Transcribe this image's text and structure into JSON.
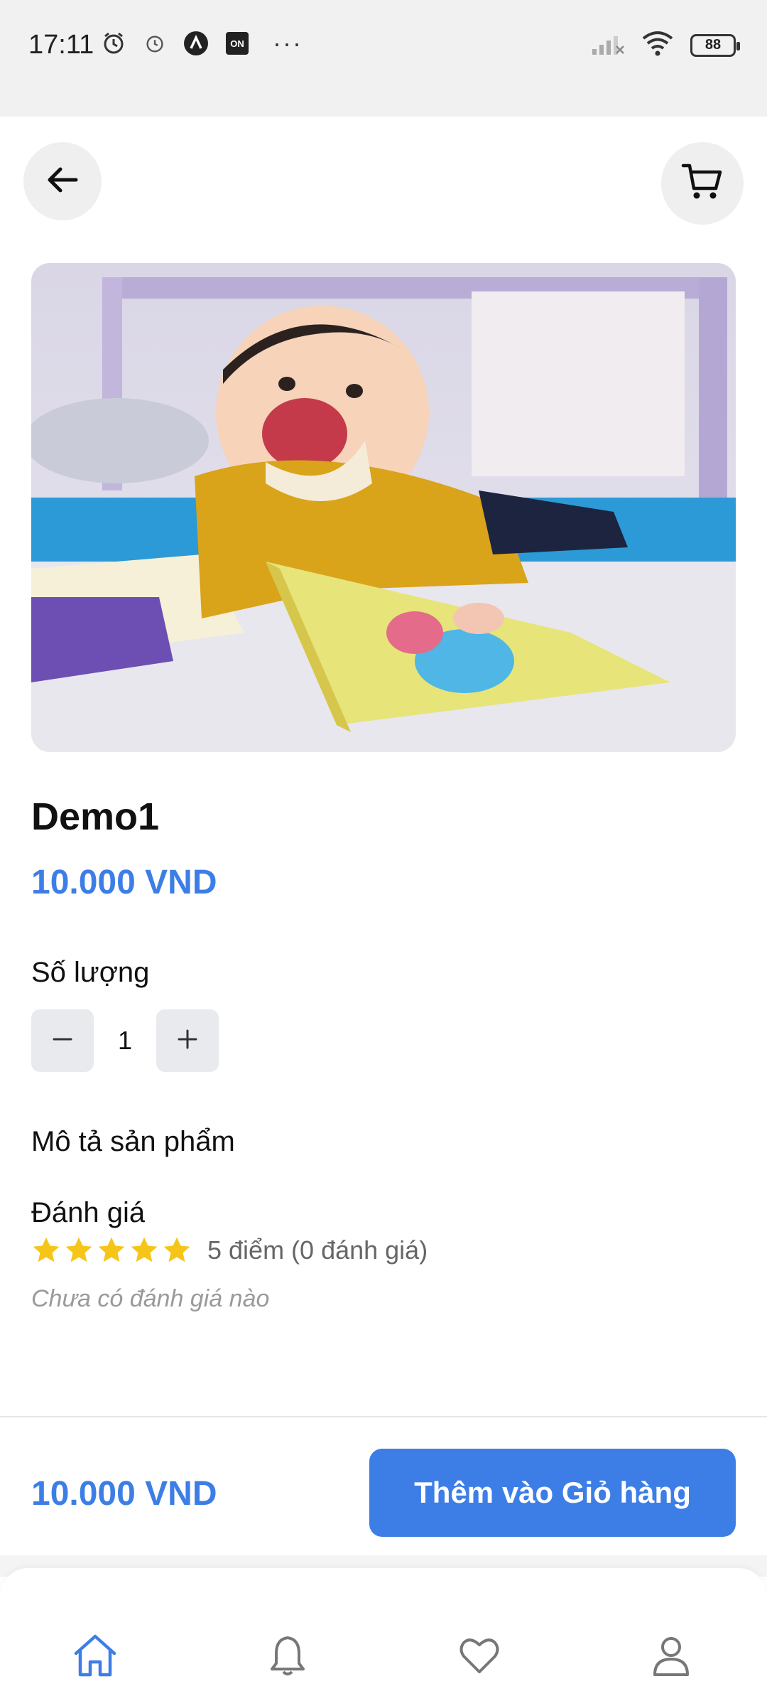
{
  "status_bar": {
    "time": "17:11",
    "battery": "88",
    "icons_left": [
      "alarm-clock-icon",
      "alarm-icon",
      "app-a-icon",
      "on-badge-icon"
    ],
    "more": "···",
    "icons_right": [
      "signal-icon",
      "wifi-icon",
      "battery-icon"
    ]
  },
  "header": {
    "back_icon": "arrow-left-icon",
    "cart_icon": "shopping-cart-icon"
  },
  "product": {
    "image_desc": "product-photo",
    "title": "Demo1",
    "price": "10.000 VND"
  },
  "quantity": {
    "label": "Số lượng",
    "value": "1",
    "minus_icon": "minus-icon",
    "plus_icon": "plus-icon"
  },
  "description": {
    "label": "Mô tả sản phẩm"
  },
  "rating": {
    "label": "Đánh giá",
    "stars": 5,
    "summary": "5 điểm (0 đánh giá)",
    "empty_text": "Chưa có đánh giá nào"
  },
  "footer": {
    "price": "10.000 VND",
    "add_to_cart": "Thêm vào Giỏ hàng"
  },
  "bottom_nav": {
    "items": [
      "home-icon",
      "bell-icon",
      "heart-icon",
      "user-icon"
    ],
    "active": "home-icon"
  },
  "colors": {
    "accent": "#3d7ee6",
    "star": "#f5c518",
    "muted": "#9a9a9a"
  }
}
